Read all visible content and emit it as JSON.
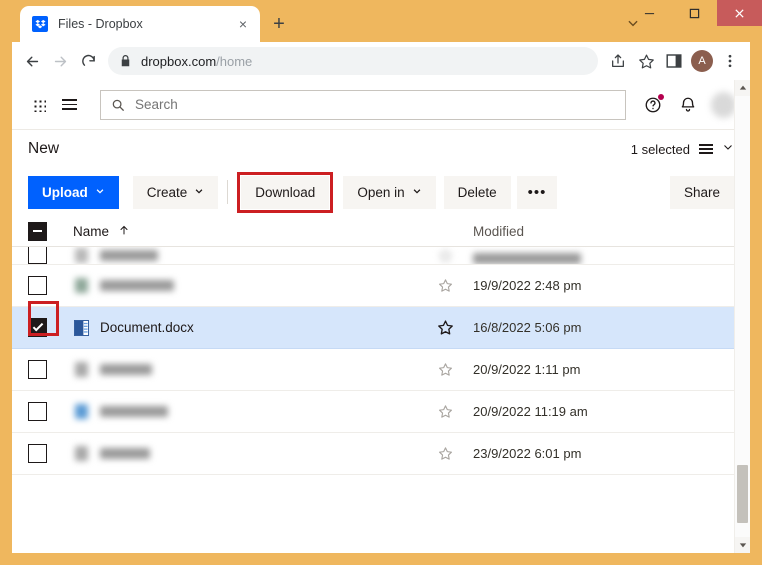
{
  "browser": {
    "tab": {
      "title": "Files - Dropbox",
      "favicon": "dropbox-favicon",
      "close_label": "×"
    },
    "new_tab_label": "+",
    "window_controls": {
      "minimize": "—",
      "maximize": "❐",
      "close": "✕"
    },
    "nav": {
      "back": "←",
      "forward": "→",
      "reload": "⟳",
      "lock_icon": "lock-icon",
      "url_domain": "dropbox.com",
      "url_path": "/home",
      "url_full": "dropbox.com/home",
      "share_icon": "share-icon",
      "bookmark_icon": "star-icon",
      "sidepanel_icon": "side-panel-icon",
      "profile_initial": "A",
      "menu_icon": "three-dot-menu-icon"
    }
  },
  "dropbox": {
    "grid_icon": "app-grid-icon",
    "menu_icon": "hamburger-menu-icon",
    "search": {
      "placeholder": "Search",
      "value": "",
      "icon": "search-icon"
    },
    "help_icon": "help-circle-icon",
    "notifications_icon": "bell-icon",
    "avatar": "user-avatar",
    "subheader": {
      "title": "New",
      "selected_text": "1 selected",
      "view_icon": "list-view-icon",
      "view_chevron": "⌄"
    },
    "toolbar": {
      "upload": "Upload",
      "create": "Create",
      "download": "Download",
      "open_in": "Open in",
      "delete": "Delete",
      "more": "•••",
      "share": "Share",
      "chevron": "⌄",
      "highlight_color": "#CC1F22",
      "primary_color": "#0061FE",
      "button_bg": "#F7F5F2"
    },
    "columns": {
      "name": "Name",
      "sort_arrow": "↑",
      "modified": "Modified"
    },
    "header_checkbox_state": "indeterminate",
    "rows": [
      {
        "name": "",
        "blurred": true,
        "clipped": true,
        "modified": "",
        "starred": false,
        "checked": false,
        "selected": false,
        "name_width": 58
      },
      {
        "name": "",
        "blurred": true,
        "clipped": false,
        "modified": "19/9/2022 2:48 pm",
        "starred": false,
        "checked": false,
        "selected": false,
        "name_width": 74,
        "icon_color": "#8FA89A"
      },
      {
        "name": "Document.docx",
        "blurred": false,
        "clipped": false,
        "modified": "16/8/2022 5:06 pm",
        "starred": true,
        "checked": true,
        "selected": true,
        "icon": "word-doc-icon"
      },
      {
        "name": "",
        "blurred": true,
        "clipped": false,
        "modified": "20/9/2022 1:11 pm",
        "starred": false,
        "checked": false,
        "selected": false,
        "name_width": 52,
        "icon_color": "#A8A8A8"
      },
      {
        "name": "",
        "blurred": true,
        "clipped": false,
        "modified": "20/9/2022 11:19 am",
        "starred": false,
        "checked": false,
        "selected": false,
        "name_width": 68,
        "icon_color": "#5B9BD5"
      },
      {
        "name": "",
        "blurred": true,
        "clipped": false,
        "modified": "23/9/2022 6:01 pm",
        "starred": false,
        "checked": false,
        "selected": false,
        "name_width": 50,
        "icon_color": "#A8A8A8"
      }
    ],
    "selected_row_color": "#D6E6FB"
  },
  "frame": {
    "border_color": "#EFB75E"
  }
}
